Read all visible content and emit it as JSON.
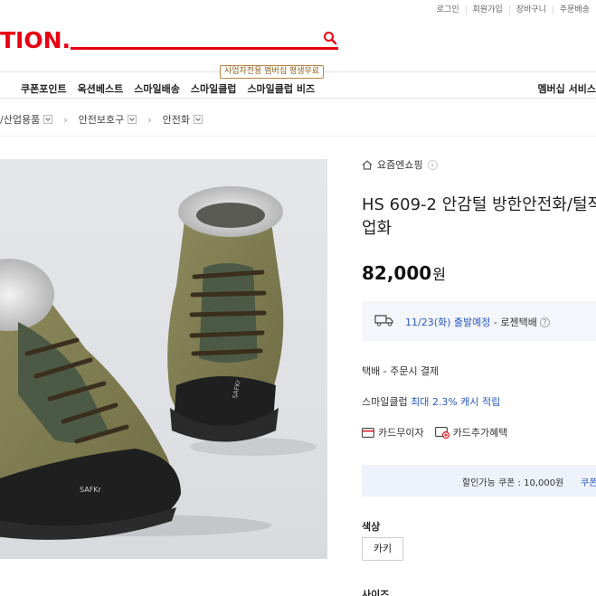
{
  "utility_links": [
    "로그인",
    "회원가입",
    "장바구니",
    "주문배송"
  ],
  "logo_text": "TION.",
  "search": {
    "placeholder": ""
  },
  "promo_badge": "사업자전용 멤버십 평생무료",
  "gnb": [
    "쿠폰포인트",
    "옥션베스트",
    "스마일배송",
    "스마일클럽",
    "스마일클럽 비즈"
  ],
  "gnb_right": "멤버십 서비스",
  "breadcrumb": [
    "/산업용품",
    "안전보호구",
    "안전화"
  ],
  "shop_name": "요즘엔쇼핑",
  "product": {
    "title": "HS 609-2 안감털 방한안전화/털작업화",
    "price": "82,000",
    "currency": "원"
  },
  "shipping": {
    "date": "11/23(화) 출발예정",
    "separator": " - ",
    "carrier": "로젠택배"
  },
  "delivery_fee": "택배 - 주문시 결제",
  "smileclub": {
    "prefix": "스마일클럽 ",
    "highlight": "최대 2.3% 캐시 적립"
  },
  "benefits": [
    "카드무이자",
    "카드추가혜택"
  ],
  "coupon": {
    "text": "할인가능 쿠폰 : 10,000원",
    "link": "쿠폰"
  },
  "options": {
    "color_label": "색상",
    "color_value": "카키",
    "size_label": "사이즈"
  },
  "photo_brand_text": "SAFKr",
  "colors": {
    "accent": "#e60012",
    "link": "#2b59c3"
  }
}
